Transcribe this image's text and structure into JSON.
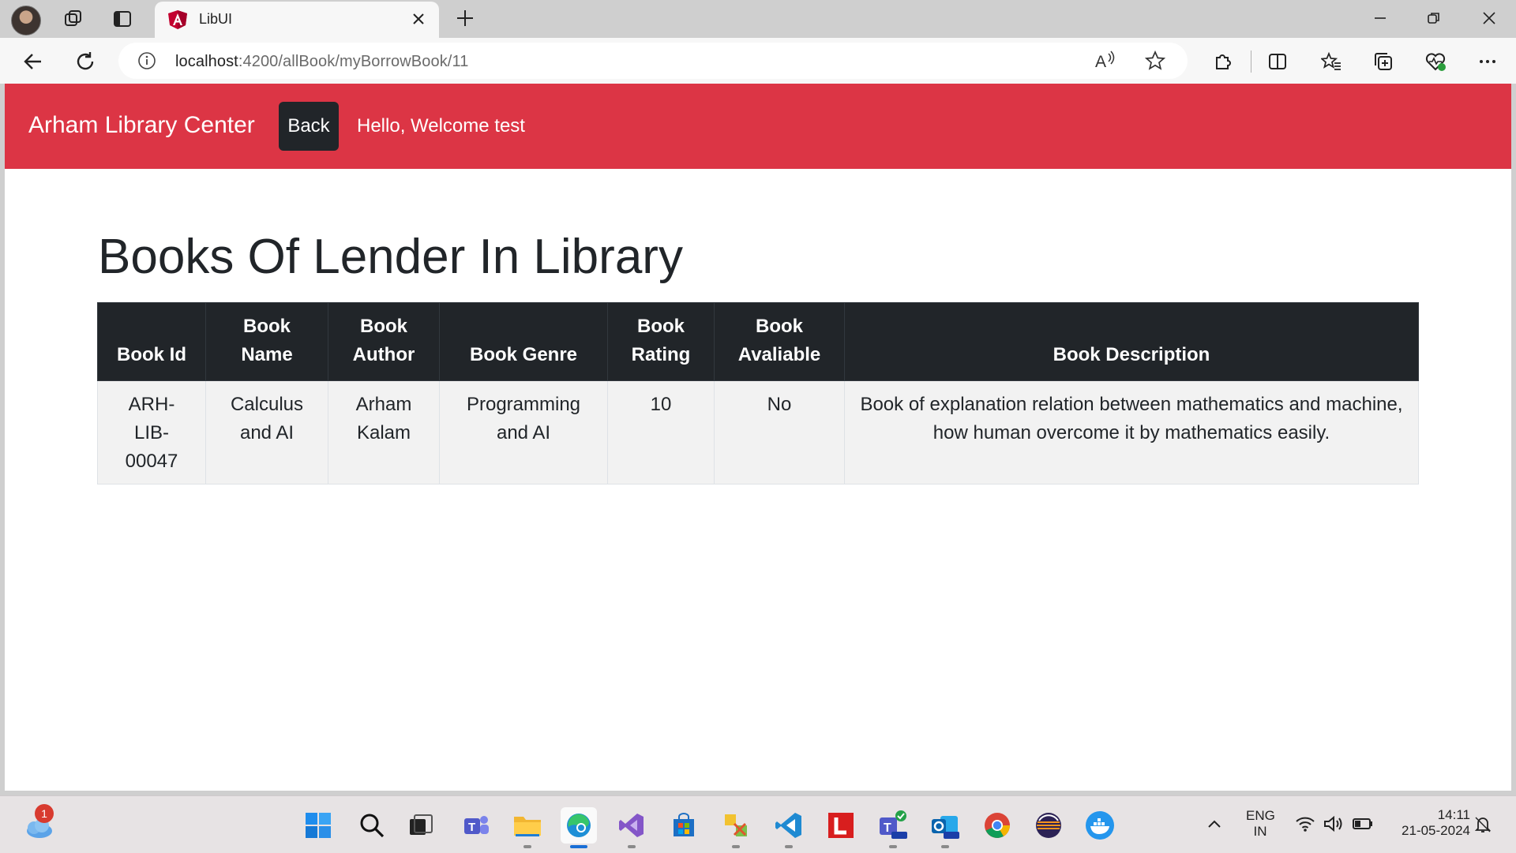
{
  "browser": {
    "tab_title": "LibUI",
    "url_host": "localhost",
    "url_path": ":4200/allBook/myBorrowBook/11"
  },
  "navbar": {
    "brand": "Arham Library Center",
    "back_label": "Back",
    "welcome": "Hello, Welcome test",
    "color": "#dc3545"
  },
  "main": {
    "title": "Books Of Lender In Library",
    "table": {
      "headers": [
        "Book Id",
        "Book Name",
        "Book Author",
        "Book Genre",
        "Book Rating",
        "Book Avaliable",
        "Book Description"
      ],
      "rows": [
        [
          "ARH-LIB-00047",
          "Calculus and AI",
          "Arham Kalam",
          "Programming and AI",
          "10",
          "No",
          "Book of explanation relation between mathematics and machine, how human overcome it by mathematics easily."
        ]
      ]
    }
  },
  "taskbar": {
    "notification_count": "1",
    "language": "ENG",
    "region": "IN",
    "time": "14:11",
    "date": "21-05-2024"
  },
  "icons": [
    "profile-avatar",
    "workspaces-icon",
    "tab-actions-icon",
    "angular-favicon",
    "close-tab-icon",
    "new-tab-icon",
    "minimize-icon",
    "restore-icon",
    "close-window-icon",
    "back-arrow-icon",
    "refresh-icon",
    "site-info-icon",
    "read-aloud-icon",
    "favorite-star-icon",
    "extensions-icon",
    "split-screen-icon",
    "favorites-icon",
    "collections-icon",
    "browser-essentials-icon",
    "more-menu-icon"
  ]
}
